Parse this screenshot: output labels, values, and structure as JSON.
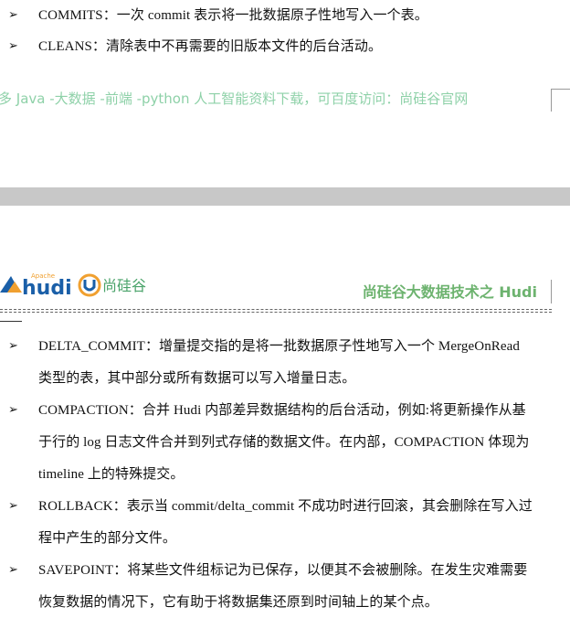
{
  "top_page": {
    "bullets": [
      {
        "lines": [
          "COMMITS：一次 commit 表示将一批数据原子性地写入一个表。"
        ]
      },
      {
        "lines": [
          "CLEANS：清除表中不再需要的旧版本文件的后台活动。"
        ]
      }
    ],
    "promo": "多 Java -大数据 -前端 -python 人工智能资料下载，可百度访问：尚硅谷官网"
  },
  "header": {
    "logo_small": "Apache",
    "logo_name": "hudi",
    "logo_brand": "尚硅谷",
    "title": "尚硅谷大数据技术之 Hudi"
  },
  "main": {
    "bullets": [
      {
        "lines": [
          "DELTA_COMMIT：增量提交指的是将一批数据原子性地写入一个 MergeOnRead",
          "类型的表，其中部分或所有数据可以写入增量日志。"
        ]
      },
      {
        "lines": [
          "COMPACTION：合并 Hudi 内部差异数据结构的后台活动，例如:将更新操作从基",
          "于行的 log 日志文件合并到列式存储的数据文件。在内部，COMPACTION 体现为",
          "timeline 上的特殊提交。"
        ]
      },
      {
        "lines": [
          "ROLLBACK：表示当 commit/delta_commit 不成功时进行回滚，其会删除在写入过",
          "程中产生的部分文件。"
        ]
      },
      {
        "lines": [
          "SAVEPOINT：将某些文件组标记为已保存，以便其不会被删除。在发生灾难需要",
          "恢复数据的情况下，它有助于将数据集还原到时间轴上的某个点。"
        ]
      }
    ]
  },
  "colors": {
    "promo": "#8ed1a8",
    "header_title": "#6db36f",
    "page_gap": "#c8c8c8",
    "logo_blue": "#1a5fa8",
    "logo_orange": "#f0a030",
    "logo_green": "#4aa36a"
  },
  "icons": {
    "bullet": "arrow-bullet-icon"
  }
}
